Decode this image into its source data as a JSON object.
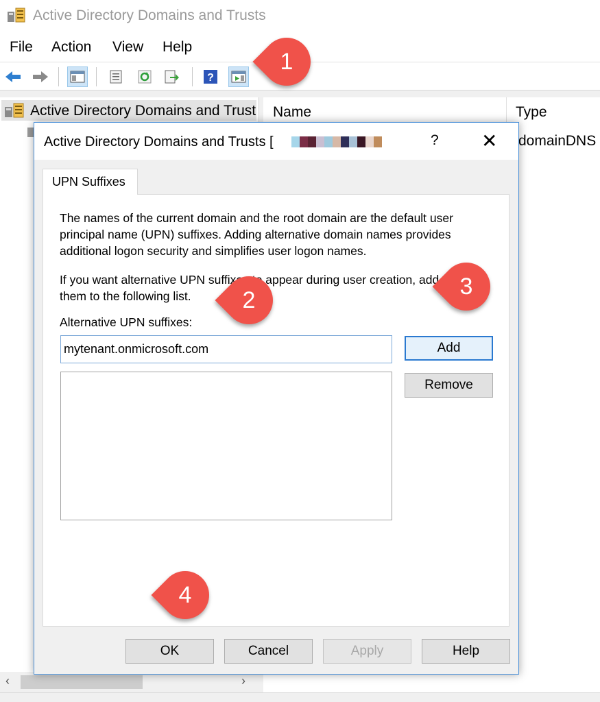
{
  "window": {
    "title": "Active Directory Domains and Trusts",
    "app_icon": "ad-domains-trusts-icon"
  },
  "menubar": {
    "items": [
      "File",
      "Action",
      "View",
      "Help"
    ]
  },
  "toolbar": {
    "buttons": [
      "back-arrow-icon",
      "forward-arrow-icon",
      "show-hide-console-tree-icon",
      "properties-icon",
      "refresh-icon",
      "export-list-icon",
      "help-icon",
      "show-hide-action-pane-icon"
    ]
  },
  "tree": {
    "root_label": "Active Directory Domains and Trust"
  },
  "list": {
    "columns": [
      "Name",
      "Type"
    ],
    "rows": [
      {
        "name": "",
        "type": "domainDNS"
      }
    ]
  },
  "dialog": {
    "title": "Active Directory Domains and Trusts [",
    "help_label": "?",
    "close_label": "✕",
    "tab_label": "UPN Suffixes",
    "description_lines": [
      "The names of the current domain and the root domain are the default user",
      "principal name (UPN) suffixes. Adding alternative domain names provides",
      "additional logon security and simplifies user logon names."
    ],
    "instruction_lines": [
      "If you want alternative UPN suffixes to appear during user creation, add",
      "them to the following list."
    ],
    "field_label": "Alternative UPN suffixes:",
    "field_value": "mytenant.onmicrosoft.com",
    "add_label": "Add",
    "remove_label": "Remove",
    "ok_label": "OK",
    "cancel_label": "Cancel",
    "apply_label": "Apply",
    "help_button_label": "Help",
    "redaction_colors": [
      "#a6d6ea",
      "#7b2e46",
      "#5a2333",
      "#c9bfd2",
      "#9fc9dd",
      "#d6b8a6",
      "#2e2e58",
      "#a8c1d6",
      "#3a1624",
      "#e9d6cd",
      "#c08c5c"
    ]
  },
  "callouts": [
    "1",
    "2",
    "3",
    "4"
  ],
  "colors": {
    "callout": "#f0524a",
    "dialog_border": "#4a90d9",
    "focus_border": "#2a79d0"
  }
}
